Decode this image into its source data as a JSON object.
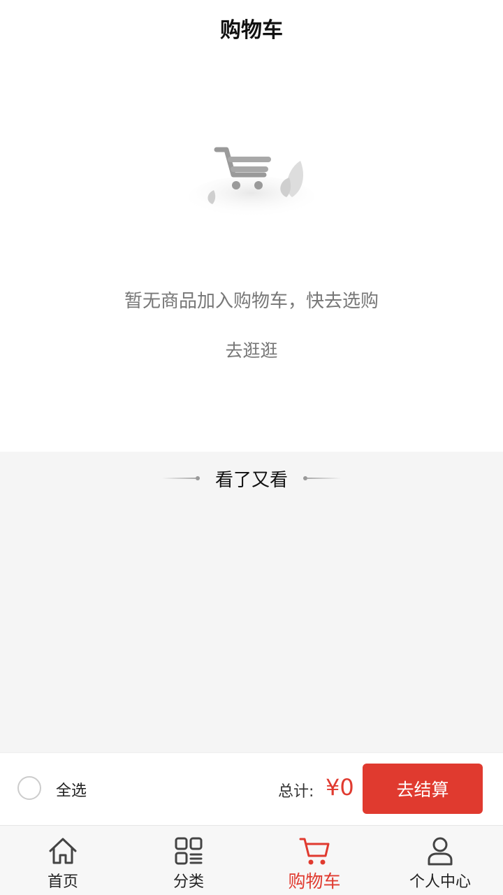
{
  "header": {
    "title": "购物车"
  },
  "empty_state": {
    "message": "暂无商品加入购物车，快去选购",
    "action_label": "去逛逛"
  },
  "recommendations": {
    "title": "看了又看"
  },
  "checkout": {
    "select_all_label": "全选",
    "total_label": "总计:",
    "total_amount": "¥0",
    "checkout_button_label": "去结算",
    "select_all_checked": false
  },
  "tabbar": {
    "tabs": [
      {
        "label": "首页",
        "icon": "home-icon",
        "active": false
      },
      {
        "label": "分类",
        "icon": "category-icon",
        "active": false
      },
      {
        "label": "购物车",
        "icon": "cart-icon",
        "active": true
      },
      {
        "label": "个人中心",
        "icon": "user-icon",
        "active": false
      }
    ]
  },
  "colors": {
    "accent": "#e03a2f",
    "text_primary": "#111111",
    "text_secondary": "#777777",
    "section_background": "#f5f5f5"
  }
}
